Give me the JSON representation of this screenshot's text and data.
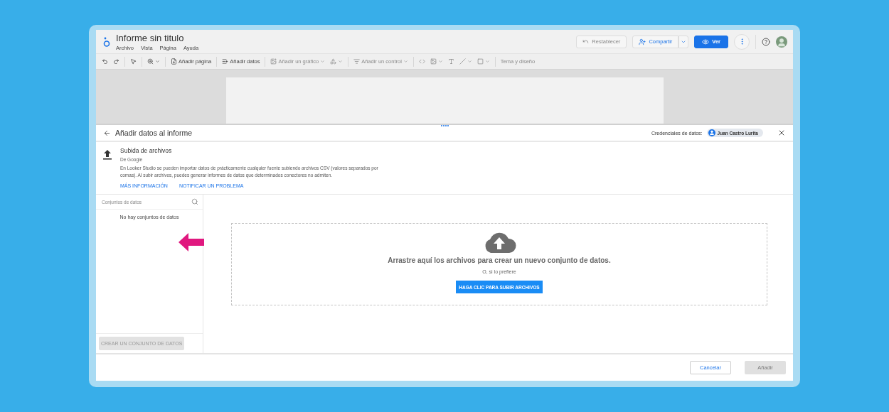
{
  "window": {
    "title": "Informe sin titulo"
  },
  "menu": [
    "Archivo",
    "Vista",
    "Página",
    "Ayuda"
  ],
  "header_actions": {
    "reset": {
      "label": "Restablecer",
      "disabled": true
    },
    "share": {
      "label": "Compartir"
    },
    "view": {
      "label": "Ver"
    }
  },
  "toolbar": [
    [
      {
        "disabled": false
      },
      {
        "disabled": false
      }
    ],
    [
      {
        "disabled": false
      }
    ],
    [
      {
        "disabled": false,
        "dropdown": true
      }
    ],
    [
      {
        "label": "Añadir página",
        "disabled": false
      }
    ],
    [
      {
        "label": "Añadir datos",
        "disabled": false
      }
    ],
    [
      {
        "label": "Añadir un gráfico",
        "disabled": true,
        "dropdown": true
      },
      {
        "disabled": true,
        "dropdown": true
      }
    ],
    [
      {
        "label": "Añadir un control",
        "disabled": true,
        "dropdown": true
      }
    ],
    [
      {
        "disabled": true
      },
      {
        "disabled": true,
        "dropdown": true
      },
      {
        "disabled": true
      },
      {
        "disabled": true,
        "dropdown": true
      },
      {
        "disabled": true,
        "dropdown": true
      }
    ],
    [
      {
        "label": "Tema y diseño",
        "disabled": true
      }
    ]
  ],
  "panel": {
    "title": "Añadir datos al informe",
    "credentials_label": "Credenciales de datos:",
    "credentials_user": "Juan Castro Lurita"
  },
  "source": {
    "title": "Subida de archivos",
    "by": "De Google",
    "description": "En Looker Studio se pueden importar datos de prácticamente cualquier fuente subiendo archivos CSV (valores separados por comas). Al subir archivos, puedes generar informes de datos que determinados conectores no admiten.",
    "links": [
      "MÁS INFORMACIÓN",
      "NOTIFICAR UN PROBLEMA"
    ]
  },
  "datasets": {
    "placeholder": "Conjuntos de datos",
    "empty": "No hay conjuntos de datos",
    "create": {
      "label": "CREAR UN CONJUNTO DE DATOS",
      "disabled": true
    }
  },
  "dropzone": {
    "message": "Arrastre aquí los archivos para crear un nuevo conjunto de datos.",
    "alt": "O, si lo prefiere",
    "button": "HAGA CLIC PARA SUBIR ARCHIVOS"
  },
  "footer": {
    "cancel": {
      "label": "Cancelar",
      "disabled": false
    },
    "add": {
      "label": "Añadir",
      "disabled": true
    }
  }
}
